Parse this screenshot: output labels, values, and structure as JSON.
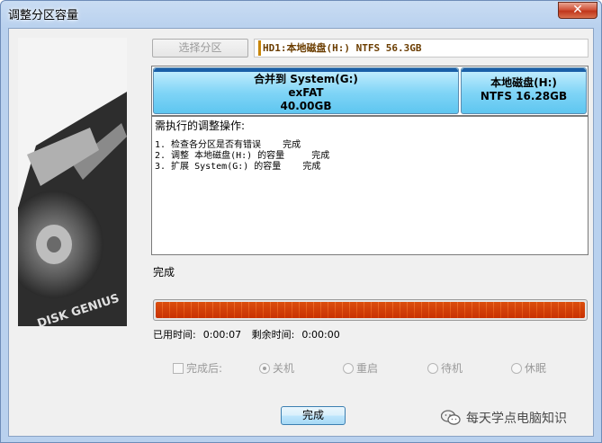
{
  "window": {
    "title": "调整分区容量",
    "close_glyph": "✕"
  },
  "top": {
    "select_partition_label": "选择分区",
    "disk_info": "HD1:本地磁盘(H:) NTFS 56.3GB"
  },
  "partitions": [
    {
      "line1": "合并到 System(G:)",
      "line2": "exFAT",
      "line3": "40.00GB"
    },
    {
      "line1": "本地磁盘(H:)",
      "line2": "NTFS 16.28GB"
    }
  ],
  "log": {
    "header": "需执行的调整操作:",
    "steps": [
      "1. 检查各分区是否有错误    完成",
      "2. 调整 本地磁盘(H:) 的容量     完成",
      "3. 扩展 System(G:) 的容量    完成"
    ]
  },
  "status_text": "完成",
  "progress": {
    "fraction": 1.0
  },
  "times": {
    "elapsed_label": "已用时间:",
    "elapsed_value": "0:00:07",
    "remaining_label": "剩余时间:",
    "remaining_value": "0:00:00"
  },
  "options": {
    "after_done_label": "完成后:",
    "radios": [
      {
        "label": "关机",
        "selected": true
      },
      {
        "label": "重启",
        "selected": false
      },
      {
        "label": "待机",
        "selected": false
      },
      {
        "label": "休眠",
        "selected": false
      }
    ]
  },
  "done_button": "完成",
  "side_art_text": "DISK GENIUS",
  "watermark": {
    "text": "每天学点电脑知识",
    "icon": "wechat-icon"
  },
  "colors": {
    "partition_fill": "#7fd4f6",
    "progress_fill": "#e2701c",
    "title_bar": "#b9d1ee"
  }
}
